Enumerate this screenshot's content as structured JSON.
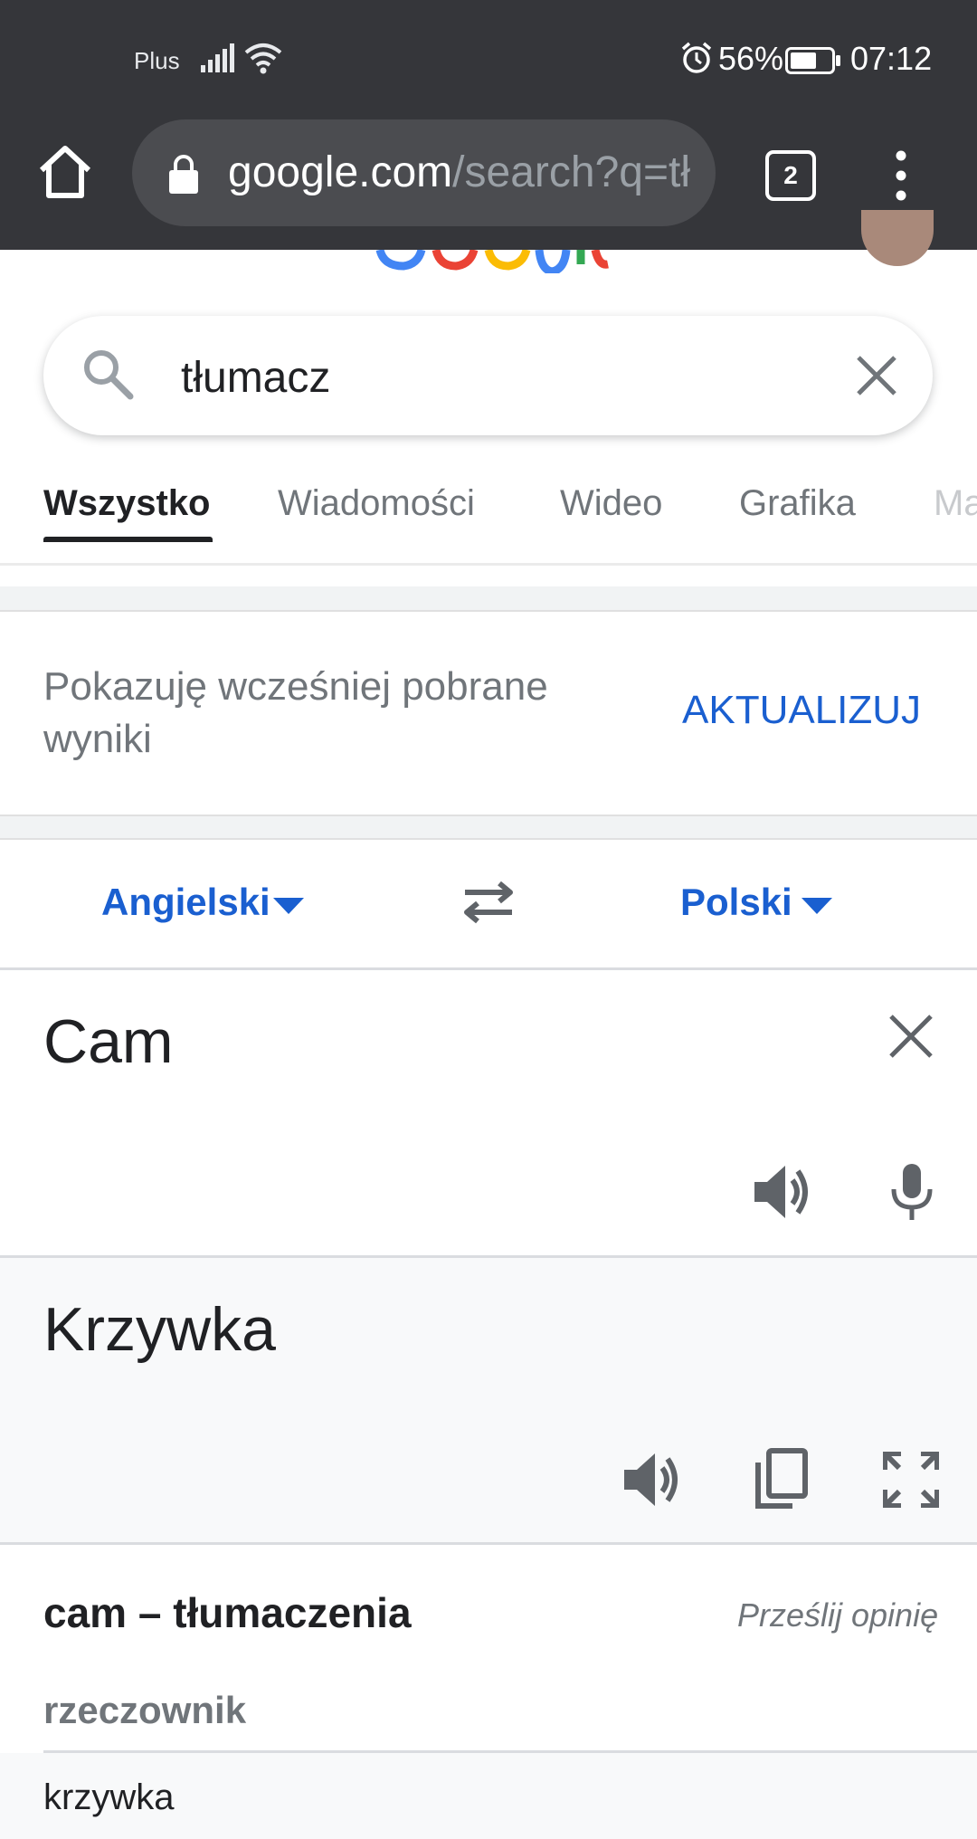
{
  "status_bar": {
    "carrier": "Plus",
    "battery_percent": "56%",
    "time": "07:12"
  },
  "browser": {
    "url_host": "google.com",
    "url_path": "/search?q=tł",
    "tab_count": "2"
  },
  "search": {
    "query": "tłumacz"
  },
  "tabs": [
    {
      "label": "Wszystko",
      "selected": true
    },
    {
      "label": "Wiadomości"
    },
    {
      "label": "Wideo"
    },
    {
      "label": "Grafika"
    },
    {
      "label": "Ma"
    }
  ],
  "offline_notice": {
    "text": "Pokazuję wcześniej pobrane wyniki",
    "action": "AKTUALIZUJ"
  },
  "translator": {
    "source_language": "Angielski",
    "target_language": "Polski",
    "source_text": "Cam",
    "translated_text": "Krzywka"
  },
  "dictionary": {
    "title": "cam – tłumaczenia",
    "feedback": "Prześlij opinię",
    "part_of_speech": "rzeczownik",
    "entries": [
      "krzywka"
    ]
  },
  "colors": {
    "chrome_bg": "#35363a",
    "accent_blue": "#1a5fd0",
    "muted_text": "#70757a"
  }
}
